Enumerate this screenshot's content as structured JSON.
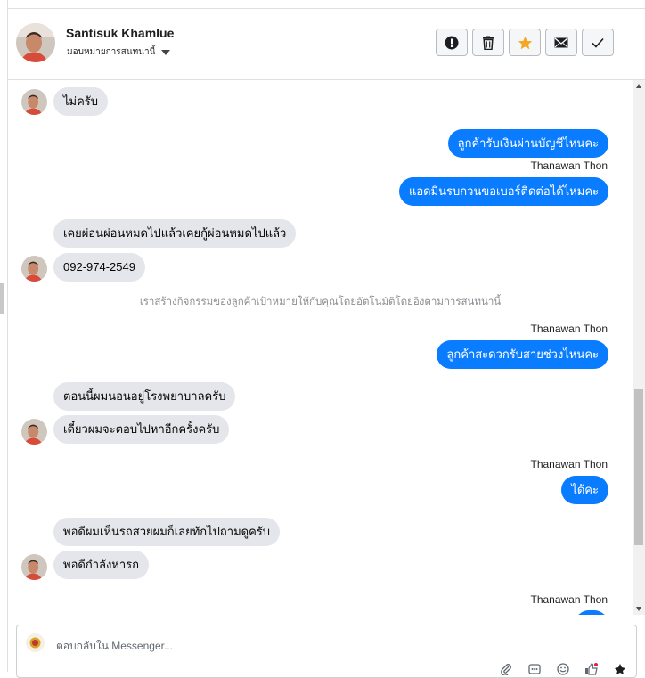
{
  "header": {
    "contact_name": "Santisuk Khamlue",
    "assign_label": "มอบหมายการสนทนานี้",
    "actions": [
      {
        "icon": "exclamation-icon"
      },
      {
        "icon": "trash-icon"
      },
      {
        "icon": "star-icon"
      },
      {
        "icon": "envelope-icon"
      },
      {
        "icon": "check-icon"
      }
    ]
  },
  "thread": {
    "m1": "ไม่ครับ",
    "m2": "ลูกค้ารับเงินผ่านบัญชีไหนคะ",
    "s1": "Thanawan Thon",
    "m3": "แอดมินรบกวนขอเบอร์ติดต่อได้ไหมคะ",
    "m4": "เคยผ่อนผ่อนหมดไปแล้วเคยกู้ผ่อนหมดไปแล้ว",
    "m5": "092-974-2549",
    "note": "เราสร้างกิจกรรมของลูกค้าเป้าหมายให้กับคุณโดยอัตโนมัติโดยอิงตามการสนทนานี้",
    "s2": "Thanawan Thon",
    "m6": "ลูกค้าสะดวกรับสายช่วงไหนคะ",
    "m7": "ตอนนี้ผมนอนอยู่โรงพยาบาลครับ",
    "m8": "เดี๋ยวผมจะตอบไปหาอีกครั้งครับ",
    "s3": "Thanawan Thon",
    "m9": "ได้คะ",
    "m10": "พอดีผมเห็นรถสวยผมก็เลยทักไปถามดูครับ",
    "m11": "พอดีกำลังหารถ",
    "s4": "Thanawan Thon"
  },
  "composer": {
    "placeholder": "ตอบกลับใน Messenger...",
    "tools": [
      "paperclip-icon",
      "template-icon",
      "emoji-icon",
      "thumbs-up-icon",
      "pin-icon"
    ]
  },
  "colors": {
    "outgoing_bubble": "#0a7cff",
    "incoming_bubble": "#e4e6eb",
    "star": "#f5a623"
  }
}
